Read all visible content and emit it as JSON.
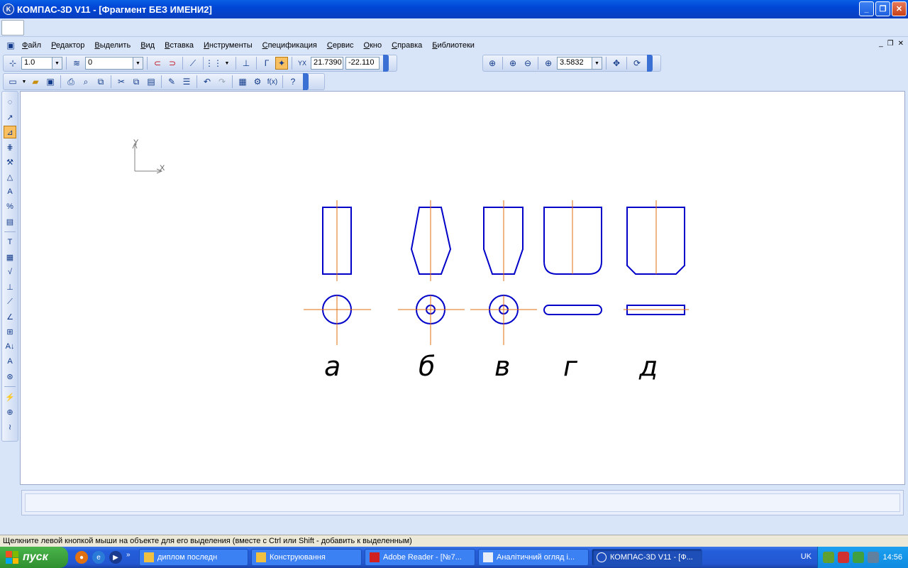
{
  "window": {
    "title": "КОМПАС-3D V11 - [Фрагмент БЕЗ ИМЕНИ2]",
    "app_icon": "kompas-icon"
  },
  "menu": {
    "items": [
      "Файл",
      "Редактор",
      "Выделить",
      "Вид",
      "Вставка",
      "Инструменты",
      "Спецификация",
      "Сервис",
      "Окно",
      "Справка",
      "Библиотеки"
    ]
  },
  "toolbar_current": {
    "step": "1.0",
    "layer": "0",
    "x_coord": "21.7390",
    "y_coord": "-22.110"
  },
  "toolbar_view": {
    "zoom": "3.5832"
  },
  "drawing": {
    "axis_x_label": "X",
    "axis_y_label": "Y",
    "labels": [
      "а",
      "б",
      "в",
      "г",
      "д"
    ],
    "outline_color": "#0000c8",
    "centerline_color": "#e07010"
  },
  "status": {
    "hint": "Щелкните левой кнопкой мыши на объекте для его выделения (вместе с Ctrl или Shift - добавить к выделенным)"
  },
  "taskbar": {
    "start_label": "пуск",
    "tasks": [
      "диплом последн",
      "Конструювання",
      "Adobe Reader - [№7...",
      "Аналітичний огляд і...",
      "КОМПАС-3D V11 - [Ф..."
    ],
    "lang": "UK",
    "clock": "14:56"
  }
}
